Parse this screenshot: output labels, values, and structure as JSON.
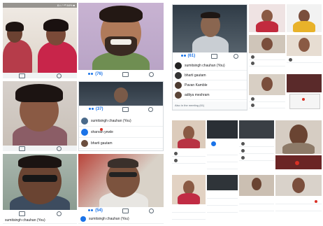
{
  "call_ui": {
    "status_bar_text": "◘ ⌂ ⁿ ᵃˡˡ 84% ■",
    "join_notice": "Also in the meeting (61)"
  },
  "counts": {
    "panel_a": "(76)",
    "panel_b": "(37)",
    "panel_c": "(54)",
    "panel_d": "(61)"
  },
  "participants": {
    "you": "sumitsingh chauhan (You)",
    "p2": "sharvan yewle",
    "p3": "bharti gautam",
    "p4": "bharti gautam",
    "p5": "Pavan Kamble",
    "p6": "aditya meshram"
  },
  "colors": {
    "accent": "#1a73e8",
    "alert": "#d93025"
  }
}
